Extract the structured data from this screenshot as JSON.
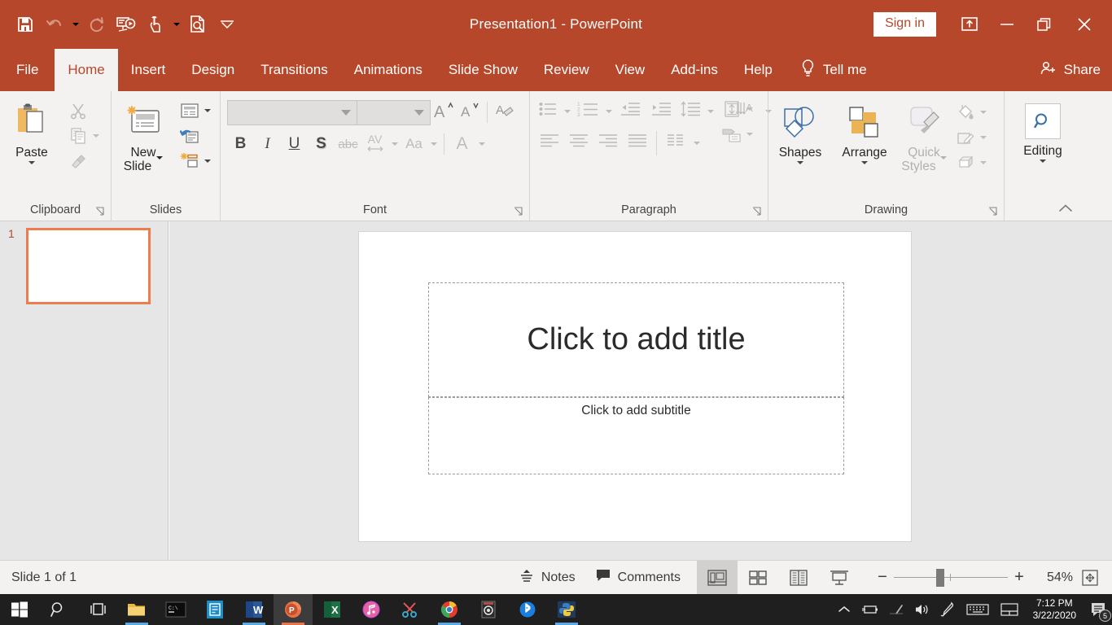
{
  "window": {
    "title": "Presentation1  -  PowerPoint",
    "accent_color": "#b7472a",
    "signin_label": "Sign in",
    "quick_access": [
      {
        "name": "save-icon",
        "label": "Save",
        "enabled": true
      },
      {
        "name": "undo-icon",
        "label": "Undo",
        "enabled": false
      },
      {
        "name": "redo-icon",
        "label": "Redo",
        "enabled": false
      },
      {
        "name": "start-presentation-icon",
        "label": "Start From Beginning",
        "enabled": true
      },
      {
        "name": "touch-mouse-mode-icon",
        "label": "Touch/Mouse Mode",
        "enabled": true
      },
      {
        "name": "print-preview-icon",
        "label": "Print Preview and Print",
        "enabled": true
      },
      {
        "name": "customize-qat-icon",
        "label": "Customize Quick Access Toolbar",
        "enabled": true
      }
    ],
    "controls": [
      {
        "name": "ribbon-display-options-icon",
        "label": "Ribbon Display Options"
      },
      {
        "name": "minimize-icon",
        "label": "Minimize"
      },
      {
        "name": "restore-icon",
        "label": "Restore Down"
      },
      {
        "name": "close-icon",
        "label": "Close"
      }
    ]
  },
  "tabs": [
    {
      "label": "File",
      "active": false
    },
    {
      "label": "Home",
      "active": true
    },
    {
      "label": "Insert",
      "active": false
    },
    {
      "label": "Design",
      "active": false
    },
    {
      "label": "Transitions",
      "active": false
    },
    {
      "label": "Animations",
      "active": false
    },
    {
      "label": "Slide Show",
      "active": false
    },
    {
      "label": "Review",
      "active": false
    },
    {
      "label": "View",
      "active": false
    },
    {
      "label": "Add-ins",
      "active": false
    },
    {
      "label": "Help",
      "active": false
    }
  ],
  "tell_me": "Tell me",
  "share": "Share",
  "ribbon": {
    "clipboard": {
      "label": "Clipboard",
      "paste": "Paste",
      "items": [
        {
          "name": "cut-icon",
          "label": "Cut"
        },
        {
          "name": "copy-icon",
          "label": "Copy"
        },
        {
          "name": "format-painter-icon",
          "label": "Format Painter"
        }
      ]
    },
    "slides": {
      "label": "Slides",
      "new_slide_line1": "New",
      "new_slide_line2": "Slide",
      "items": [
        {
          "name": "layout-icon",
          "label": "Layout"
        },
        {
          "name": "reset-icon",
          "label": "Reset"
        },
        {
          "name": "section-icon",
          "label": "Section"
        }
      ]
    },
    "font": {
      "label": "Font",
      "font_name_value": "",
      "font_name_placeholder": "",
      "font_size_value": "",
      "font_size_placeholder": "",
      "buttons": [
        {
          "name": "increase-font-size-icon",
          "label": "Increase Font Size"
        },
        {
          "name": "decrease-font-size-icon",
          "label": "Decrease Font Size"
        },
        {
          "name": "clear-formatting-icon",
          "label": "Clear All Formatting"
        }
      ],
      "bold": "B",
      "italic": "I",
      "underline": "U",
      "shadow": "S",
      "strikethrough": "abc",
      "char_spacing": "AV",
      "change_case": "Aa",
      "font_color": "A"
    },
    "paragraph": {
      "label": "Paragraph",
      "buttons": [
        {
          "name": "bullets-icon",
          "label": "Bullets"
        },
        {
          "name": "numbering-icon",
          "label": "Numbering"
        },
        {
          "name": "decrease-indent-icon",
          "label": "Decrease List Level"
        },
        {
          "name": "increase-indent-icon",
          "label": "Increase List Level"
        },
        {
          "name": "line-spacing-icon",
          "label": "Line Spacing"
        },
        {
          "name": "text-direction-icon",
          "label": "Text Direction"
        },
        {
          "name": "align-text-icon",
          "label": "Align Text"
        },
        {
          "name": "convert-smartart-icon",
          "label": "Convert to SmartArt"
        },
        {
          "name": "align-left-icon",
          "label": "Align Left"
        },
        {
          "name": "align-center-icon",
          "label": "Center"
        },
        {
          "name": "align-right-icon",
          "label": "Align Right"
        },
        {
          "name": "justify-icon",
          "label": "Justify"
        },
        {
          "name": "columns-icon",
          "label": "Add or Remove Columns"
        }
      ]
    },
    "drawing": {
      "label": "Drawing",
      "shapes": "Shapes",
      "arrange": "Arrange",
      "quick_styles_line1": "Quick",
      "quick_styles_line2": "Styles",
      "items": [
        {
          "name": "shape-fill-icon",
          "label": "Shape Fill"
        },
        {
          "name": "shape-outline-icon",
          "label": "Shape Outline"
        },
        {
          "name": "shape-effects-icon",
          "label": "Shape Effects"
        }
      ]
    },
    "editing": {
      "label": "Editing",
      "icon": "search-icon"
    },
    "collapse": {
      "name": "collapse-ribbon-icon",
      "label": "Collapse the Ribbon"
    }
  },
  "slide_panel": {
    "slide_number": "1",
    "selection_color": "#ed7d4e"
  },
  "slide": {
    "title_placeholder": "Click to add title",
    "subtitle_placeholder": "Click to add subtitle"
  },
  "status_bar": {
    "slide_count": "Slide 1 of 1",
    "notes": "Notes",
    "comments": "Comments",
    "views": [
      {
        "name": "normal-view-icon",
        "label": "Normal",
        "active": true
      },
      {
        "name": "slide-sorter-view-icon",
        "label": "Slide Sorter",
        "active": false
      },
      {
        "name": "reading-view-icon",
        "label": "Reading View",
        "active": false
      },
      {
        "name": "slide-show-view-icon",
        "label": "Slide Show",
        "active": false
      }
    ],
    "zoom_out": "−",
    "zoom_in": "+",
    "zoom_level": "54%",
    "zoom_slider_percent": 40,
    "fit_button": "fit-slide-to-window-icon"
  },
  "taskbar": {
    "items": [
      {
        "name": "start-button",
        "label": "Start"
      },
      {
        "name": "taskbar-search-icon",
        "label": "Search"
      },
      {
        "name": "task-view-icon",
        "label": "Task View"
      },
      {
        "name": "file-explorer-icon",
        "label": "File Explorer",
        "running": true
      },
      {
        "name": "command-prompt-icon",
        "label": "Command Prompt"
      },
      {
        "name": "teams-icon",
        "label": "Microsoft Teams"
      },
      {
        "name": "word-icon",
        "label": "Word",
        "running": true
      },
      {
        "name": "powerpoint-icon",
        "label": "PowerPoint",
        "running": true,
        "active": true
      },
      {
        "name": "excel-icon",
        "label": "Excel"
      },
      {
        "name": "itunes-icon",
        "label": "iTunes"
      },
      {
        "name": "snipping-tool-icon",
        "label": "Snip & Sketch"
      },
      {
        "name": "chrome-icon",
        "label": "Google Chrome",
        "running": true
      },
      {
        "name": "camera-icon",
        "label": "Camera"
      },
      {
        "name": "bluetooth-icon",
        "label": "Bluetooth"
      },
      {
        "name": "python-icon",
        "label": "Python",
        "running": true
      }
    ],
    "tray": [
      {
        "name": "show-hidden-icons-icon",
        "label": "Show hidden icons"
      },
      {
        "name": "battery-icon",
        "label": "Battery"
      },
      {
        "name": "wifi-icon",
        "label": "Network"
      },
      {
        "name": "volume-icon",
        "label": "Volume"
      },
      {
        "name": "pen-icon",
        "label": "Windows Ink"
      },
      {
        "name": "keyboard-icon",
        "label": "Touch keyboard"
      },
      {
        "name": "touchpad-icon",
        "label": "Touchpad"
      }
    ],
    "clock_time": "7:12 PM",
    "clock_date": "3/22/2020",
    "notification_count": "5"
  }
}
